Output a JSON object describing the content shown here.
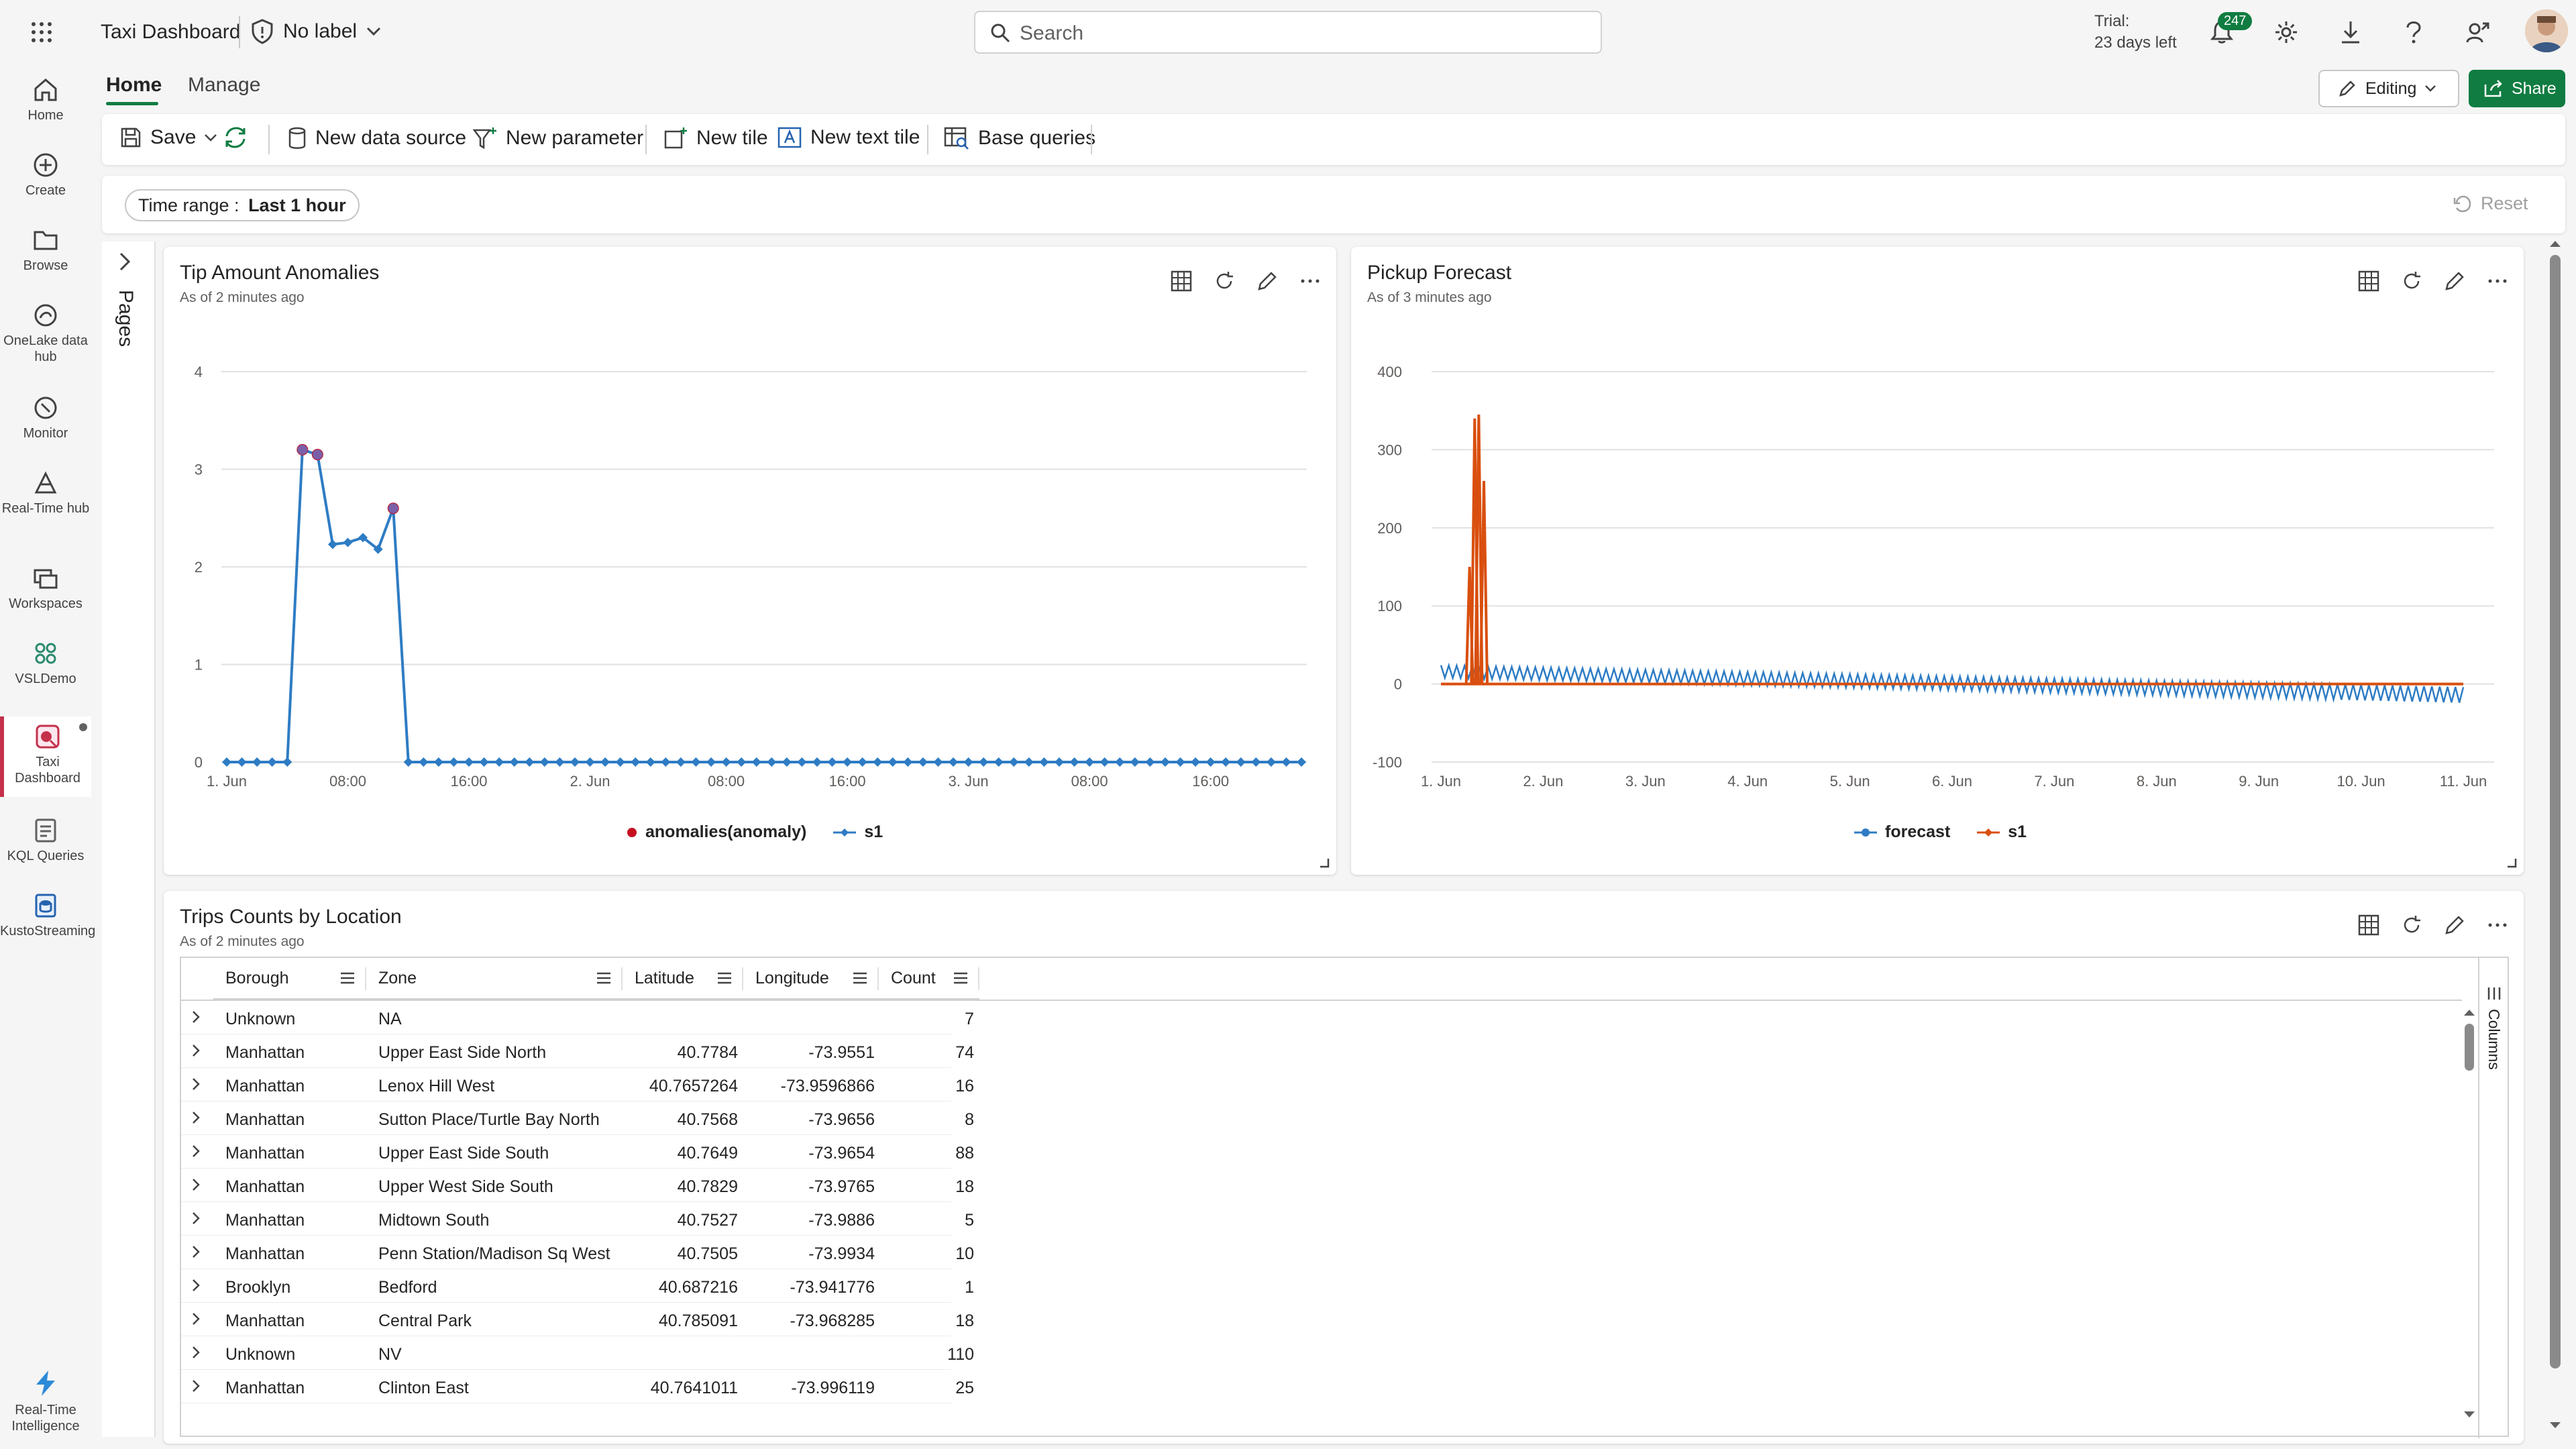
{
  "app": {
    "title": "Taxi Dashboard",
    "label": "No label",
    "search_placeholder": "Search",
    "trial_line1": "Trial:",
    "trial_line2": "23 days left",
    "notification_count": "247",
    "accent": "#107c41"
  },
  "rail": [
    {
      "label": "Home",
      "icon": "home-icon"
    },
    {
      "label": "Create",
      "icon": "plus-circle-icon"
    },
    {
      "label": "Browse",
      "icon": "folder-icon"
    },
    {
      "label": "OneLake data hub",
      "icon": "onelake-icon"
    },
    {
      "label": "Monitor",
      "icon": "monitor-icon"
    },
    {
      "label": "Real-Time hub",
      "icon": "realtime-hub-icon"
    },
    {
      "label": "Workspaces",
      "icon": "workspaces-icon"
    },
    {
      "label": "VSLDemo",
      "icon": "vsldemo-icon"
    },
    {
      "label": "Taxi Dashboard",
      "icon": "dashboard-icon"
    },
    {
      "label": "KQL Queries",
      "icon": "kql-icon"
    },
    {
      "label": "KustoStreaming",
      "icon": "kusto-icon"
    }
  ],
  "rail_bottom": {
    "label": "Real-Time Intelligence"
  },
  "tabs": {
    "home": "Home",
    "manage": "Manage"
  },
  "editing": "Editing",
  "share": "Share",
  "toolbar": {
    "save": "Save",
    "new_data_source": "New data source",
    "new_parameter": "New parameter",
    "new_tile": "New tile",
    "new_text_tile": "New text tile",
    "base_queries": "Base queries"
  },
  "params": {
    "time_range_label": "Time range : ",
    "time_range_value": "Last 1 hour",
    "reset": "Reset"
  },
  "pages_label": "Pages",
  "tiles": {
    "tip": {
      "title": "Tip Amount Anomalies",
      "subtitle": "As of 2 minutes ago"
    },
    "pickup": {
      "title": "Pickup Forecast",
      "subtitle": "As of 3 minutes ago"
    },
    "trips": {
      "title": "Trips Counts by Location",
      "subtitle": "As of 2 minutes ago"
    }
  },
  "chart_data": [
    {
      "type": "line",
      "title": "Tip Amount Anomalies",
      "x_tick_labels": [
        "1. Jun",
        "08:00",
        "16:00",
        "2. Jun",
        "08:00",
        "16:00",
        "3. Jun",
        "08:00",
        "16:00"
      ],
      "ylim": [
        0,
        4
      ],
      "y_ticks": [
        0,
        1,
        2,
        3,
        4
      ],
      "grid": true,
      "legend_position": "bottom",
      "series": [
        {
          "name": "anomalies(anomaly)",
          "color": "#c50f1f",
          "values": [
            0,
            0,
            0,
            0,
            0,
            3.2,
            3.15,
            0,
            0,
            0,
            0,
            2.6,
            0,
            0,
            0,
            0,
            0,
            0,
            0,
            0,
            0,
            0,
            0,
            0,
            0,
            0,
            0,
            0,
            0,
            0,
            0,
            0,
            0,
            0,
            0,
            0,
            0,
            0,
            0,
            0,
            0,
            0,
            0,
            0,
            0,
            0,
            0,
            0,
            0,
            0,
            0,
            0,
            0,
            0,
            0,
            0,
            0,
            0,
            0,
            0,
            0,
            0,
            0,
            0,
            0,
            0,
            0,
            0,
            0,
            0,
            0,
            0
          ]
        },
        {
          "name": "s1",
          "color": "#2e7cc4",
          "values": [
            0,
            0,
            0,
            0,
            0,
            3.2,
            3.15,
            2.23,
            2.25,
            2.3,
            2.18,
            2.6,
            0,
            0,
            0,
            0,
            0,
            0,
            0,
            0,
            0,
            0,
            0,
            0,
            0,
            0,
            0,
            0,
            0,
            0,
            0,
            0,
            0,
            0,
            0,
            0,
            0,
            0,
            0,
            0,
            0,
            0,
            0,
            0,
            0,
            0,
            0,
            0,
            0,
            0,
            0,
            0,
            0,
            0,
            0,
            0,
            0,
            0,
            0,
            0,
            0,
            0,
            0,
            0,
            0,
            0,
            0,
            0,
            0,
            0,
            0,
            0
          ]
        }
      ]
    },
    {
      "type": "line",
      "title": "Pickup Forecast",
      "x_tick_labels": [
        "1. Jun",
        "2. Jun",
        "3. Jun",
        "4. Jun",
        "5. Jun",
        "6. Jun",
        "7. Jun",
        "8. Jun",
        "9. Jun",
        "10. Jun",
        "11. Jun"
      ],
      "ylim": [
        -100,
        400
      ],
      "y_ticks": [
        -100,
        0,
        100,
        200,
        300,
        400
      ],
      "grid": true,
      "legend_position": "bottom",
      "series": [
        {
          "name": "forecast",
          "color": "#2e7cc4",
          "envelope_start": [
            8,
            24
          ],
          "envelope_end": [
            -24,
            -4
          ]
        },
        {
          "name": "s1",
          "color": "#d94f0f",
          "spikes": [
            {
              "x": 0.28,
              "y": 150
            },
            {
              "x": 0.33,
              "y": 340
            },
            {
              "x": 0.37,
              "y": 345
            },
            {
              "x": 0.42,
              "y": 260
            }
          ],
          "baseline": [
            {
              "x": 0,
              "y": 0
            },
            {
              "x": 10,
              "y": 0
            }
          ]
        }
      ]
    }
  ],
  "table": {
    "columns": [
      "Borough",
      "Zone",
      "Latitude",
      "Longitude",
      "Count"
    ],
    "side_panel": "Columns",
    "rows": [
      [
        "Unknown",
        "NA",
        "",
        "",
        "7"
      ],
      [
        "Manhattan",
        "Upper East Side North",
        "40.7784",
        "-73.9551",
        "74"
      ],
      [
        "Manhattan",
        "Lenox Hill West",
        "40.7657264",
        "-73.9596866",
        "16"
      ],
      [
        "Manhattan",
        "Sutton Place/Turtle Bay North",
        "40.7568",
        "-73.9656",
        "8"
      ],
      [
        "Manhattan",
        "Upper East Side South",
        "40.7649",
        "-73.9654",
        "88"
      ],
      [
        "Manhattan",
        "Upper West Side South",
        "40.7829",
        "-73.9765",
        "18"
      ],
      [
        "Manhattan",
        "Midtown South",
        "40.7527",
        "-73.9886",
        "5"
      ],
      [
        "Manhattan",
        "Penn Station/Madison Sq West",
        "40.7505",
        "-73.9934",
        "10"
      ],
      [
        "Brooklyn",
        "Bedford",
        "40.687216",
        "-73.941776",
        "1"
      ],
      [
        "Manhattan",
        "Central Park",
        "40.785091",
        "-73.968285",
        "18"
      ],
      [
        "Unknown",
        "NV",
        "",
        "",
        "110"
      ],
      [
        "Manhattan",
        "Clinton East",
        "40.7641011",
        "-73.996119",
        "25"
      ]
    ]
  }
}
